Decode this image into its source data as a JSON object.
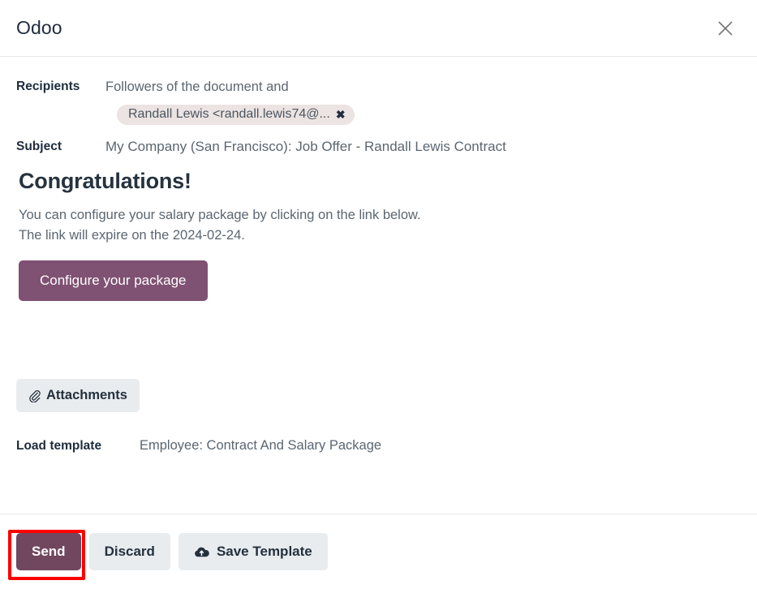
{
  "header": {
    "title": "Odoo",
    "close_icon": "close-icon"
  },
  "form": {
    "recipients_label": "Recipients",
    "recipients_text": "Followers of the document and",
    "recipient_chip": {
      "label": "Randall Lewis <randall.lewis74@...",
      "remove_icon": "✖"
    },
    "subject_label": "Subject",
    "subject_value": "My Company (San Francisco): Job Offer - Randall Lewis Contract"
  },
  "mail": {
    "heading": "Congratulations!",
    "line1": "You can configure your salary package by clicking on the link below.",
    "line2": "The link will expire on the 2024-02-24.",
    "cta_label": "Configure your package",
    "cta_color": "#7f5173"
  },
  "attachments": {
    "label": "Attachments",
    "icon": "paperclip-icon"
  },
  "template": {
    "label": "Load template",
    "selected": "Employee: Contract And Salary Package"
  },
  "footer": {
    "send_label": "Send",
    "discard_label": "Discard",
    "save_template_label": "Save Template",
    "save_template_icon": "cloud-upload-icon",
    "send_color": "#71475f",
    "highlight_color": "#ff0000"
  }
}
